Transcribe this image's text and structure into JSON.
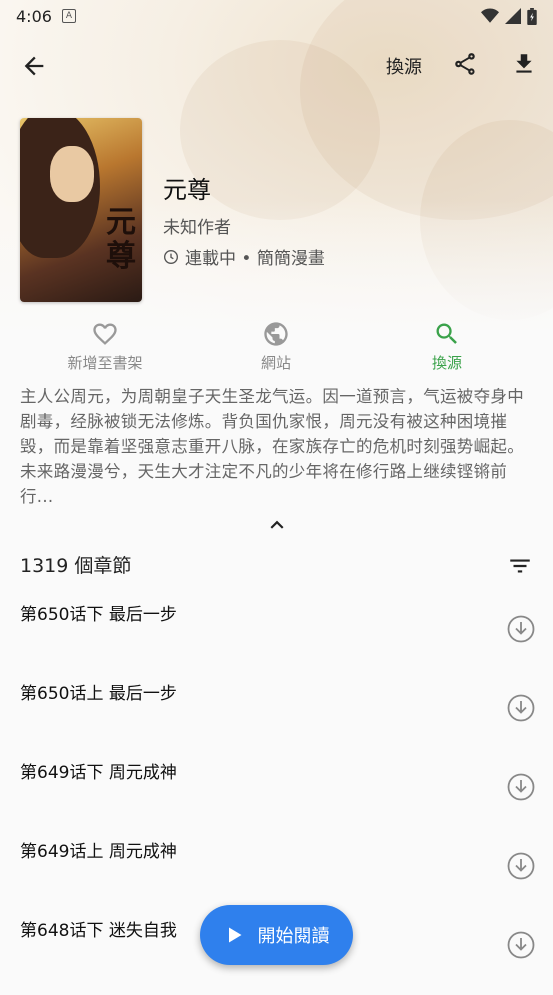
{
  "status_bar": {
    "time": "4:06",
    "notification_glyph": "A"
  },
  "toolbar": {
    "source_label": "換源"
  },
  "manga": {
    "title": "元尊",
    "author": "未知作者",
    "status": "連載中 • 簡簡漫畫",
    "cover_glyph": "元尊"
  },
  "actions": [
    {
      "label": "新增至書架",
      "icon": "heart-outline-icon",
      "active": false
    },
    {
      "label": "網站",
      "icon": "globe-icon",
      "active": false
    },
    {
      "label": "換源",
      "icon": "search-icon",
      "active": true
    }
  ],
  "description": "主人公周元，为周朝皇子天生圣龙气运。因一道预言，气运被夺身中剧毒，经脉被锁无法修炼。背负国仇家恨，周元没有被这种困境摧毁，而是靠着坚强意志重开八脉，在家族存亡的危机时刻强势崛起。未来路漫漫兮，天生大才注定不凡的少年将在修行路上继续铿锵前行...",
  "chapters": {
    "count_label": "1319 個章節",
    "items": [
      {
        "title": "第650话下 最后一步"
      },
      {
        "title": "第650话上 最后一步"
      },
      {
        "title": "第649话下 周元成神"
      },
      {
        "title": "第649话上 周元成神"
      },
      {
        "title": "第648话下 迷失自我"
      }
    ]
  },
  "fab": {
    "label": "開始閱讀"
  },
  "colors": {
    "accent_green": "#3aa24a",
    "fab_blue": "#2f80ed"
  }
}
